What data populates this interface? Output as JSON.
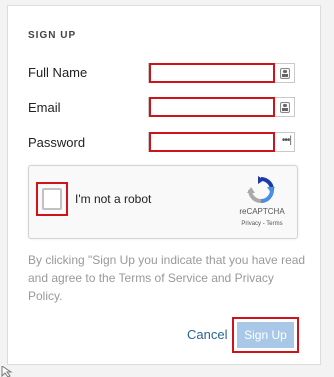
{
  "form": {
    "heading": "SIGN UP",
    "fields": [
      {
        "label": "Full Name",
        "value": "",
        "placeholder": ""
      },
      {
        "label": "Email",
        "value": "",
        "placeholder": ""
      },
      {
        "label": "Password",
        "value": "",
        "placeholder": ""
      }
    ],
    "captcha": {
      "checkbox_label": "I'm not a robot",
      "brand": "reCAPTCHA",
      "terms": "Privacy - Terms"
    },
    "disclaimer": "By clicking \"Sign Up you indicate that you have read and agree to the Terms of Service and Privacy Policy.",
    "cancel_label": "Cancel",
    "submit_label": "Sign Up"
  },
  "colors": {
    "highlight": "#d0121b",
    "button": "#a9c8e8",
    "link": "#2a6496"
  },
  "icons": [
    "contact-card-icon",
    "password-dots-icon",
    "recaptcha-logo-icon",
    "mouse-cursor-icon"
  ]
}
